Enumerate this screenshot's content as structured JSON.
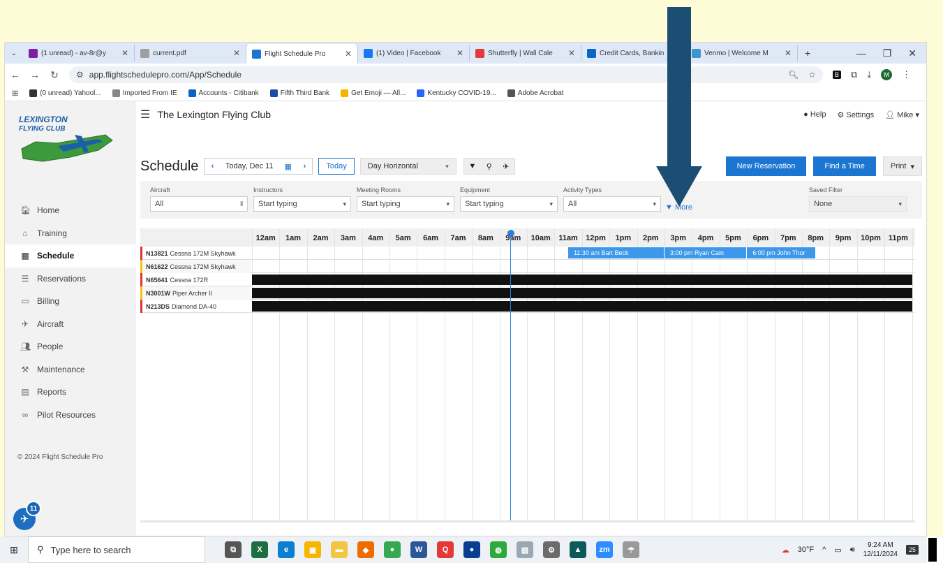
{
  "browser": {
    "tabs": [
      {
        "label": "(1 unread) - av-8r@y",
        "icon_color": "#7b1fa2"
      },
      {
        "label": "current.pdf",
        "icon_color": "#9e9e9e"
      },
      {
        "label": "Flight Schedule Pro",
        "icon_color": "#1b76d2",
        "active": true
      },
      {
        "label": "(1) Video | Facebook",
        "icon_color": "#1877f2"
      },
      {
        "label": "Shutterfly | Wall Cale",
        "icon_color": "#e53935"
      },
      {
        "label": "Credit Cards, Bankin",
        "icon_color": "#0a66c2"
      },
      {
        "label": "Venmo | Welcome M",
        "icon_color": "#3d95ce"
      }
    ],
    "url": "app.flightschedulepro.com/App/Schedule",
    "bookmarks": [
      {
        "label": "(0 unread) Yahool...",
        "color": "#333"
      },
      {
        "label": "Imported From IE",
        "color": "#888"
      },
      {
        "label": "Accounts - Citibank",
        "color": "#0a66c2"
      },
      {
        "label": "Fifth Third Bank",
        "color": "#1a4ea3"
      },
      {
        "label": "Get Emoji — All...",
        "color": "#f4b400"
      },
      {
        "label": "Kentucky COVID-19...",
        "color": "#2962ff"
      },
      {
        "label": "Adobe Acrobat",
        "color": "#555"
      }
    ],
    "profile_initial": "M"
  },
  "header": {
    "club_name": "The Lexington Flying Club",
    "help": "Help",
    "settings": "Settings",
    "user": "Mike"
  },
  "sidebar": {
    "logo_text_1": "LEXINGTON",
    "logo_text_2": "FLYING CLUB",
    "items": [
      {
        "label": "Home",
        "icon": "home-icon",
        "glyph": "🏠︎"
      },
      {
        "label": "Training",
        "icon": "training-icon",
        "glyph": "⌂"
      },
      {
        "label": "Schedule",
        "icon": "calendar-icon",
        "glyph": "▦"
      },
      {
        "label": "Reservations",
        "icon": "list-icon",
        "glyph": "☰"
      },
      {
        "label": "Billing",
        "icon": "billing-icon",
        "glyph": "▭"
      },
      {
        "label": "Aircraft",
        "icon": "plane-icon",
        "glyph": "✈"
      },
      {
        "label": "People",
        "icon": "people-icon",
        "glyph": "👥︎"
      },
      {
        "label": "Maintenance",
        "icon": "wrench-icon",
        "glyph": "⚒"
      },
      {
        "label": "Reports",
        "icon": "reports-icon",
        "glyph": "▤"
      },
      {
        "label": "Pilot Resources",
        "icon": "link-icon",
        "glyph": "∞"
      }
    ],
    "copyright": "© 2024 Flight Schedule Pro",
    "notification_count": "11"
  },
  "schedule": {
    "title": "Schedule",
    "date": "Today, Dec 11",
    "today_label": "Today",
    "view": "Day Horizontal",
    "new_reservation": "New Reservation",
    "find_time": "Find a Time",
    "print": "Print"
  },
  "filters": {
    "aircraft_label": "Aircraft",
    "aircraft_value": "All",
    "instructors_label": "Instructors",
    "instructors_placeholder": "Start typing",
    "rooms_label": "Meeting Rooms",
    "rooms_placeholder": "Start typing",
    "equipment_label": "Equipment",
    "equipment_placeholder": "Start typing",
    "activity_label": "Activity Types",
    "activity_value": "All",
    "more": "More",
    "saved_label": "Saved Filter",
    "saved_value": "None"
  },
  "timeline": {
    "hours": [
      "12am",
      "1am",
      "2am",
      "3am",
      "4am",
      "5am",
      "6am",
      "7am",
      "8am",
      "9am",
      "10am",
      "11am",
      "12pm",
      "1pm",
      "2pm",
      "3pm",
      "4pm",
      "5pm",
      "6pm",
      "7pm",
      "8pm",
      "9pm",
      "10pm",
      "11pm"
    ],
    "now_hour": 9.4,
    "aircraft": [
      {
        "tail": "N13821",
        "model": "Cessna 172M Skyhawk",
        "status_color": "#d33",
        "reservations": [
          {
            "label": "11:30 am Bart Beck",
            "start": 11.5,
            "end": 15.0
          },
          {
            "label": "3:00 pm Ryan Cain",
            "start": 15.0,
            "end": 18.0
          },
          {
            "label": "6:00 pm John Thor",
            "start": 18.0,
            "end": 20.5
          }
        ],
        "blocked": false
      },
      {
        "tail": "N61622",
        "model": "Cessna 172M Skyhawk",
        "status_color": "#f0c419",
        "reservations": [],
        "blocked": false
      },
      {
        "tail": "N65641",
        "model": "Cessna 172R",
        "status_color": "#d33",
        "reservations": [],
        "blocked": true
      },
      {
        "tail": "N3001W",
        "model": "Piper Archer II",
        "status_color": "#f0c419",
        "reservations": [],
        "blocked": true
      },
      {
        "tail": "N213DS",
        "model": "Diamond DA-40",
        "status_color": "#d33",
        "reservations": [],
        "blocked": true
      }
    ]
  },
  "taskbar": {
    "search_placeholder": "Type here to search",
    "weather": "30°F",
    "time": "9:24 AM",
    "date": "12/11/2024",
    "notifications": "25",
    "apps": [
      {
        "name": "task-view",
        "color": "#555",
        "glyph": "⧉"
      },
      {
        "name": "excel",
        "color": "#1d6f42",
        "glyph": "X"
      },
      {
        "name": "edge",
        "color": "#0c7fd2",
        "glyph": "e"
      },
      {
        "name": "app3",
        "color": "#f7b500",
        "glyph": "▣"
      },
      {
        "name": "file-explorer",
        "color": "#f4c542",
        "glyph": "▬"
      },
      {
        "name": "app5",
        "color": "#ef6c00",
        "glyph": "◆"
      },
      {
        "name": "chrome",
        "color": "#34a853",
        "glyph": "●"
      },
      {
        "name": "word",
        "color": "#2b579a",
        "glyph": "W"
      },
      {
        "name": "app8",
        "color": "#e53935",
        "glyph": "Q"
      },
      {
        "name": "app9",
        "color": "#0b3d91",
        "glyph": "●"
      },
      {
        "name": "app10",
        "color": "#2eaa3c",
        "glyph": "◍"
      },
      {
        "name": "photos",
        "color": "#9aa7b5",
        "glyph": "▧"
      },
      {
        "name": "settings",
        "color": "#6b6b6b",
        "glyph": "⚙"
      },
      {
        "name": "app13",
        "color": "#0d5a5a",
        "glyph": "▲"
      },
      {
        "name": "zoom",
        "color": "#2d8cff",
        "glyph": "zm"
      },
      {
        "name": "app15",
        "color": "#999",
        "glyph": "☂"
      }
    ]
  }
}
